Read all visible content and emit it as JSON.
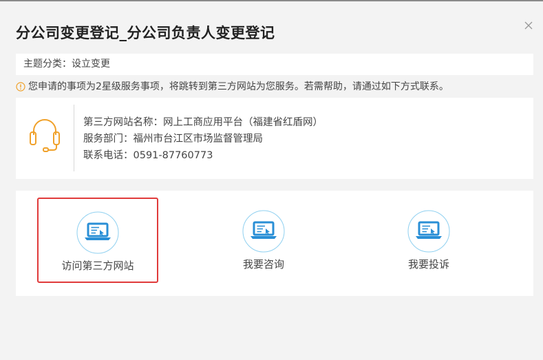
{
  "dialog": {
    "title": "分公司变更登记_分公司负责人变更登记",
    "close_icon": "close-icon"
  },
  "category": {
    "text": "主题分类：设立变更"
  },
  "notice": {
    "icon": "info-circle-icon",
    "text": "您申请的事项为2星级服务事项，将跳转到第三方网站为您服务。若需帮助，请通过如下方式联系。"
  },
  "contact": {
    "icon": "headset-icon",
    "site_name": "第三方网站名称：网上工商应用平台（福建省红盾网）",
    "department": "服务部门：福州市台江区市场监督管理局",
    "phone": "联系电话：0591-87760773"
  },
  "actions": [
    {
      "label": "访问第三方网站",
      "icon": "laptop-icon",
      "selected": true
    },
    {
      "label": "我要咨询",
      "icon": "laptop-icon",
      "selected": false
    },
    {
      "label": "我要投诉",
      "icon": "laptop-icon",
      "selected": false
    }
  ],
  "colors": {
    "accent_blue": "#2a8fd6",
    "headset_orange": "#f0a12a",
    "selection_red": "#e03a3a",
    "notice_orange": "#f0a12a"
  }
}
